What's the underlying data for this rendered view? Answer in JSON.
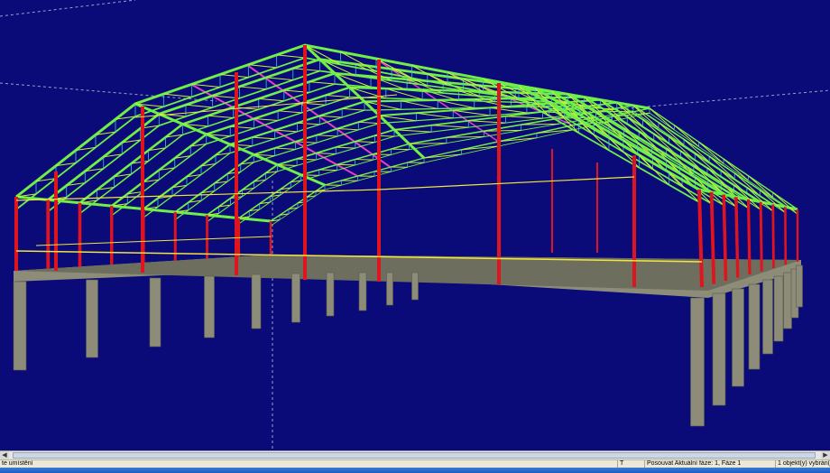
{
  "statusbar": {
    "hint": "te umístění",
    "mode": "T",
    "phase": "Posouvat  Aktuální fáze: 1, Fáze 1",
    "selection": "1 objekt(y) vybrán(y)"
  },
  "colors": {
    "background": "#0a0a78",
    "column": "#e0141e",
    "truss_main": "#6ef046",
    "truss_bracing": "#c8f03c",
    "purlin": "#e640c8",
    "secondary": "#38c8d8",
    "foundation": "#8c8c78",
    "tie": "#f0e640"
  },
  "scrollbar": {
    "left_arrow": "◀",
    "right_arrow": "▶"
  }
}
